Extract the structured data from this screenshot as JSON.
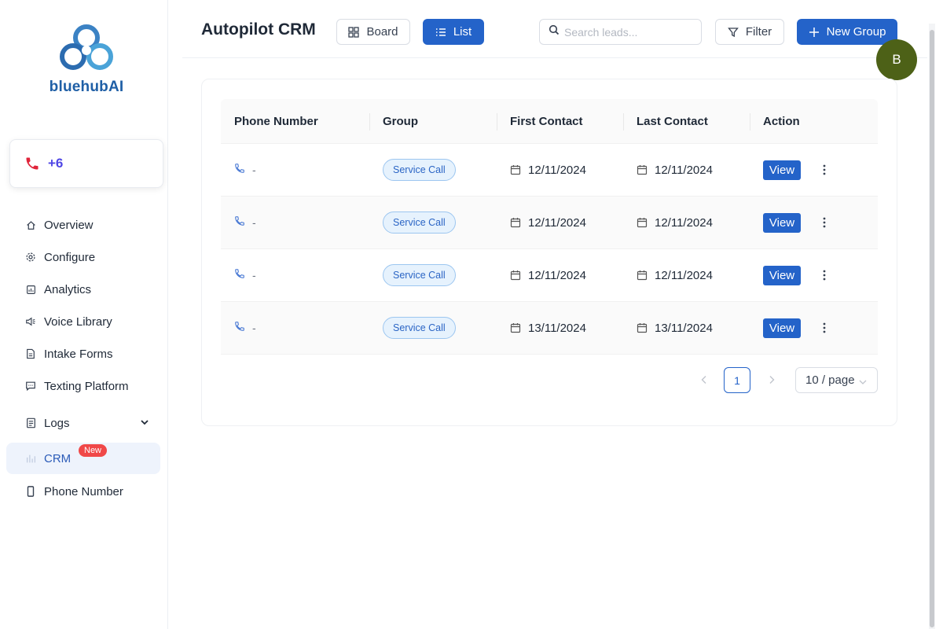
{
  "brand": {
    "name_main": "bluehub",
    "name_ai": "AI"
  },
  "phone_card": {
    "number_prefix": "+6"
  },
  "sidebar": {
    "items": [
      {
        "label": "Overview",
        "icon": "home-icon"
      },
      {
        "label": "Configure",
        "icon": "gear-icon"
      },
      {
        "label": "Analytics",
        "icon": "analytics-icon"
      },
      {
        "label": "Voice Library",
        "icon": "speaker-icon"
      },
      {
        "label": "Intake Forms",
        "icon": "form-icon"
      },
      {
        "label": "Texting Platform",
        "icon": "message-icon"
      },
      {
        "label": "Logs",
        "icon": "logs-icon"
      },
      {
        "label": "CRM",
        "icon": "crm-icon",
        "badge": "New"
      },
      {
        "label": "Phone Number",
        "icon": "phone-device-icon"
      }
    ]
  },
  "header": {
    "title": "Autopilot CRM",
    "board_label": "Board",
    "list_label": "List",
    "search_placeholder": "Search leads...",
    "filter_label": "Filter",
    "new_group_label": "New Group"
  },
  "avatar": {
    "initial": "B",
    "color": "#4d6117"
  },
  "table": {
    "columns": [
      "Phone Number",
      "Group",
      "First Contact",
      "Last Contact",
      "Action"
    ],
    "rows": [
      {
        "phone": "-",
        "group": "Service Call",
        "first": "12/11/2024",
        "last": "12/11/2024",
        "action": "View"
      },
      {
        "phone": "-",
        "group": "Service Call",
        "first": "12/11/2024",
        "last": "12/11/2024",
        "action": "View"
      },
      {
        "phone": "-",
        "group": "Service Call",
        "first": "12/11/2024",
        "last": "12/11/2024",
        "action": "View"
      },
      {
        "phone": "-",
        "group": "Service Call",
        "first": "13/11/2024",
        "last": "13/11/2024",
        "action": "View"
      }
    ]
  },
  "pagination": {
    "current_page": "1",
    "page_size": "10 / page"
  },
  "colors": {
    "primary": "#2463c9",
    "badge": "#f04848",
    "tag_bg": "#e6f2fd"
  }
}
